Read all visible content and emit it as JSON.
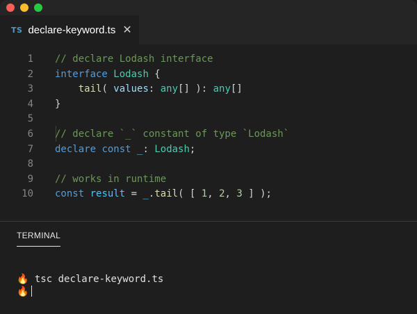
{
  "tab": {
    "icon_text": "TS",
    "filename": "declare-keyword.ts",
    "close_glyph": "✕"
  },
  "editor": {
    "lines": [
      {
        "num": "1",
        "tokens": [
          {
            "t": "// declare Lodash interface",
            "k": "comment"
          }
        ]
      },
      {
        "num": "2",
        "tokens": [
          {
            "t": "interface",
            "k": "keyword"
          },
          {
            "t": " ",
            "k": "punct"
          },
          {
            "t": "Lodash",
            "k": "type"
          },
          {
            "t": " {",
            "k": "punct"
          }
        ]
      },
      {
        "num": "3",
        "tokens": [
          {
            "t": "    ",
            "k": "punct"
          },
          {
            "t": "tail",
            "k": "func"
          },
          {
            "t": "( ",
            "k": "punct"
          },
          {
            "t": "values",
            "k": "var"
          },
          {
            "t": ": ",
            "k": "punct"
          },
          {
            "t": "any",
            "k": "type"
          },
          {
            "t": "[] ): ",
            "k": "punct"
          },
          {
            "t": "any",
            "k": "type"
          },
          {
            "t": "[]",
            "k": "punct"
          }
        ]
      },
      {
        "num": "4",
        "tokens": [
          {
            "t": "}",
            "k": "punct"
          }
        ]
      },
      {
        "num": "5",
        "tokens": []
      },
      {
        "num": "6",
        "tokens": [
          {
            "t": "// declare `_` constant of type `Lodash`",
            "k": "comment"
          }
        ]
      },
      {
        "num": "7",
        "tokens": [
          {
            "t": "declare",
            "k": "keyword"
          },
          {
            "t": " ",
            "k": "punct"
          },
          {
            "t": "const",
            "k": "keyword"
          },
          {
            "t": " ",
            "k": "punct"
          },
          {
            "t": "_",
            "k": "const"
          },
          {
            "t": ": ",
            "k": "punct"
          },
          {
            "t": "Lodash",
            "k": "type"
          },
          {
            "t": ";",
            "k": "punct"
          }
        ]
      },
      {
        "num": "8",
        "tokens": []
      },
      {
        "num": "9",
        "tokens": [
          {
            "t": "// works in runtime",
            "k": "comment"
          }
        ]
      },
      {
        "num": "10",
        "tokens": [
          {
            "t": "const",
            "k": "keyword"
          },
          {
            "t": " ",
            "k": "punct"
          },
          {
            "t": "result",
            "k": "const"
          },
          {
            "t": " = ",
            "k": "punct"
          },
          {
            "t": "_",
            "k": "const"
          },
          {
            "t": ".",
            "k": "punct"
          },
          {
            "t": "tail",
            "k": "func"
          },
          {
            "t": "( [ ",
            "k": "punct"
          },
          {
            "t": "1",
            "k": "num"
          },
          {
            "t": ", ",
            "k": "punct"
          },
          {
            "t": "2",
            "k": "num"
          },
          {
            "t": ", ",
            "k": "punct"
          },
          {
            "t": "3",
            "k": "num"
          },
          {
            "t": " ] );",
            "k": "punct"
          }
        ]
      }
    ]
  },
  "panel": {
    "tab_label": "TERMINAL",
    "terminal_lines": [
      {
        "prompt": "🔥",
        "command": "tsc declare-keyword.ts"
      },
      {
        "prompt": "🔥",
        "command": ""
      }
    ]
  },
  "colors": {
    "comment": "#6a9955",
    "keyword": "#569cd6",
    "type": "#4ec9b0",
    "variable": "#9cdcfe",
    "constant": "#4fc1ff",
    "function": "#dcdcaa",
    "number": "#b5cea8"
  }
}
